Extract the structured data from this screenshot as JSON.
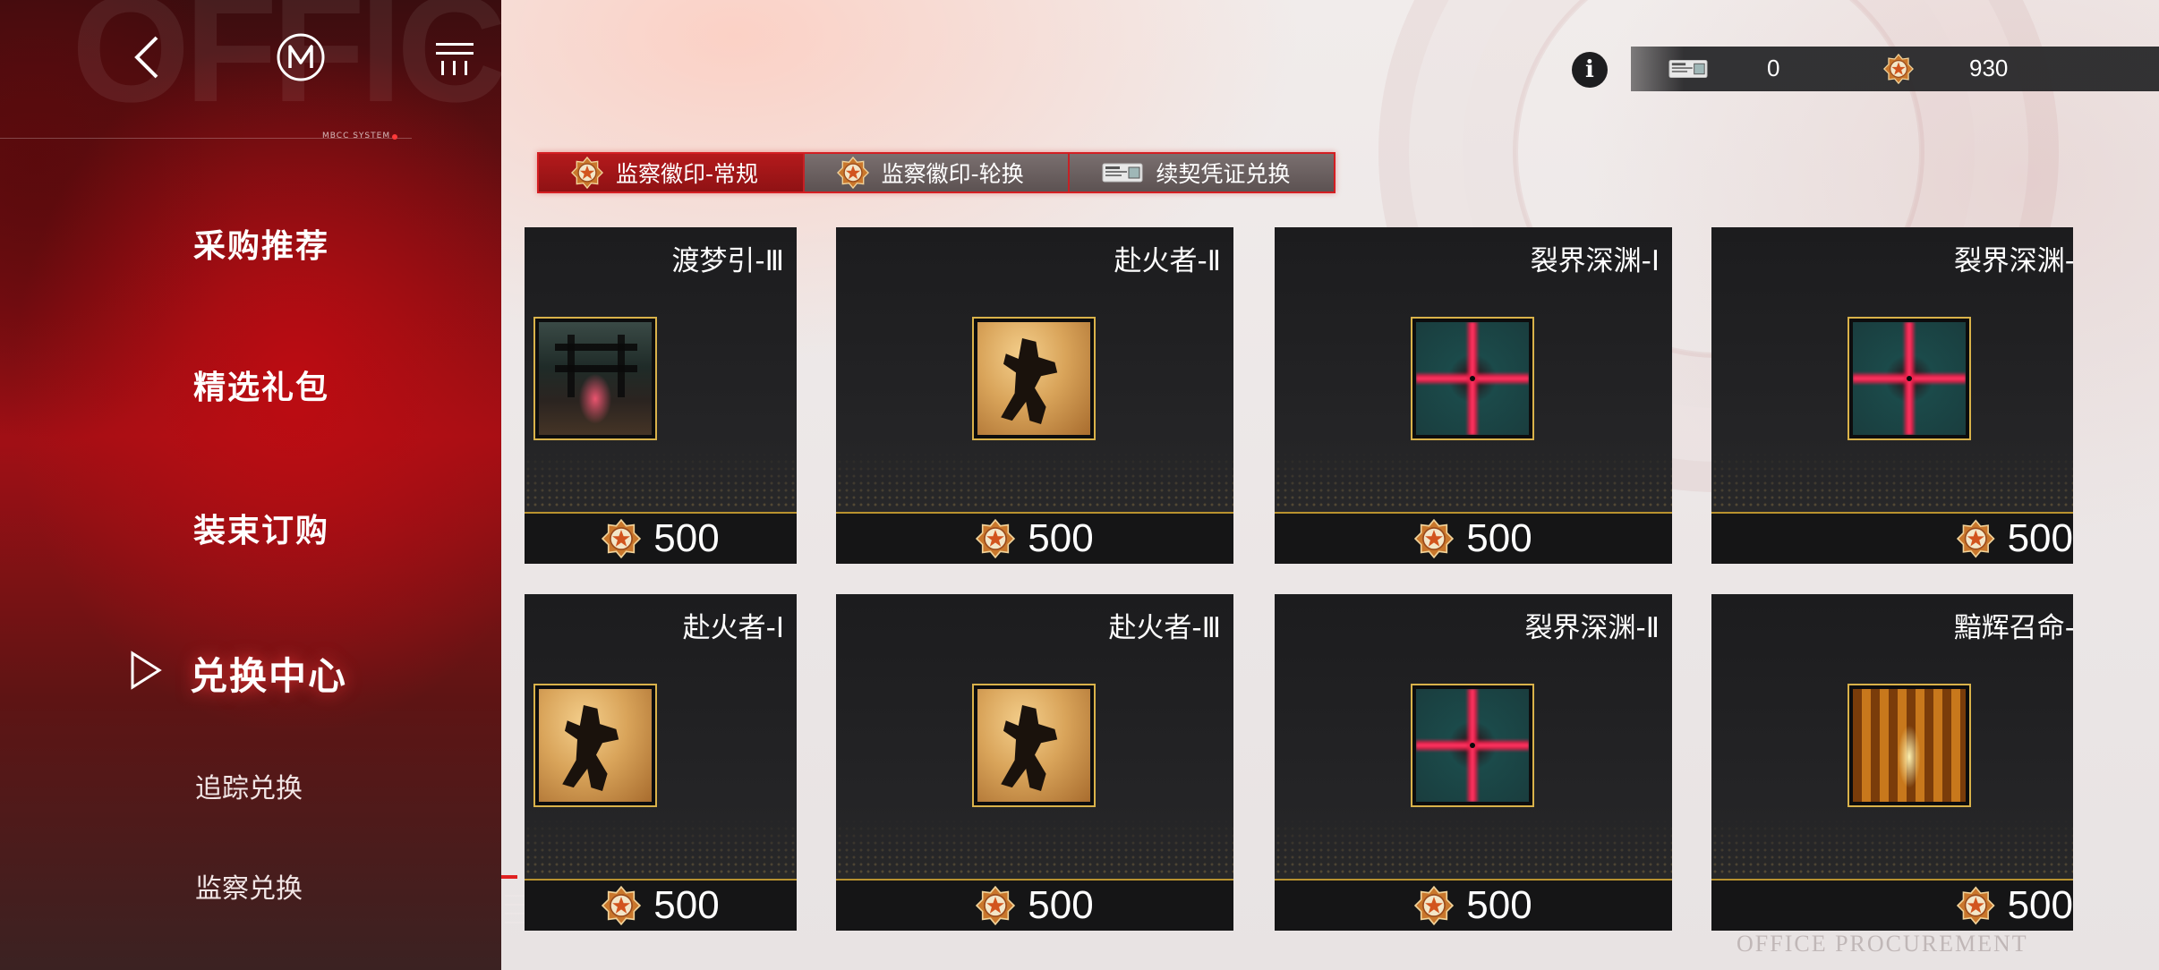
{
  "background": {
    "watermark_text": "OFFICE PROCUREMENT",
    "footer_watermark": "OFFICE PROCUREMENT"
  },
  "sidebar": {
    "system_label": "MBCC SYSTEM",
    "items": [
      {
        "label": "采购推荐"
      },
      {
        "label": "精选礼包"
      },
      {
        "label": "装束订购"
      },
      {
        "label": "兑换中心",
        "active": true
      }
    ],
    "sub_items": [
      {
        "label": "追踪兑换"
      },
      {
        "label": "监察兑换"
      },
      {
        "label": "..."
      }
    ]
  },
  "currency": {
    "voucher_value": "0",
    "badge_value": "930"
  },
  "tabs": [
    {
      "label": "监察徽印-常规",
      "icon": "badge-icon",
      "active": true
    },
    {
      "label": "监察徽印-轮换",
      "icon": "badge-icon",
      "active": false
    },
    {
      "label": "续契凭证兑换",
      "icon": "ticket-icon",
      "active": false
    }
  ],
  "items": [
    {
      "title": "渡梦引-Ⅲ",
      "price": "500",
      "art": "dream"
    },
    {
      "title": "赴火者-Ⅱ",
      "price": "500",
      "art": "fire"
    },
    {
      "title": "裂界深渊-Ⅰ",
      "price": "500",
      "art": "abyss"
    },
    {
      "title": "裂界深渊-",
      "price": "500",
      "art": "abyss"
    },
    {
      "title": "赴火者-Ⅰ",
      "price": "500",
      "art": "fire"
    },
    {
      "title": "赴火者-Ⅲ",
      "price": "500",
      "art": "fire"
    },
    {
      "title": "裂界深渊-Ⅱ",
      "price": "500",
      "art": "abyss"
    },
    {
      "title": "黯辉召命-",
      "price": "500",
      "art": "gold"
    }
  ],
  "colors": {
    "accent_red": "#d41e22",
    "gold": "#d9b24a",
    "card_bg": "#1c1c1e"
  }
}
